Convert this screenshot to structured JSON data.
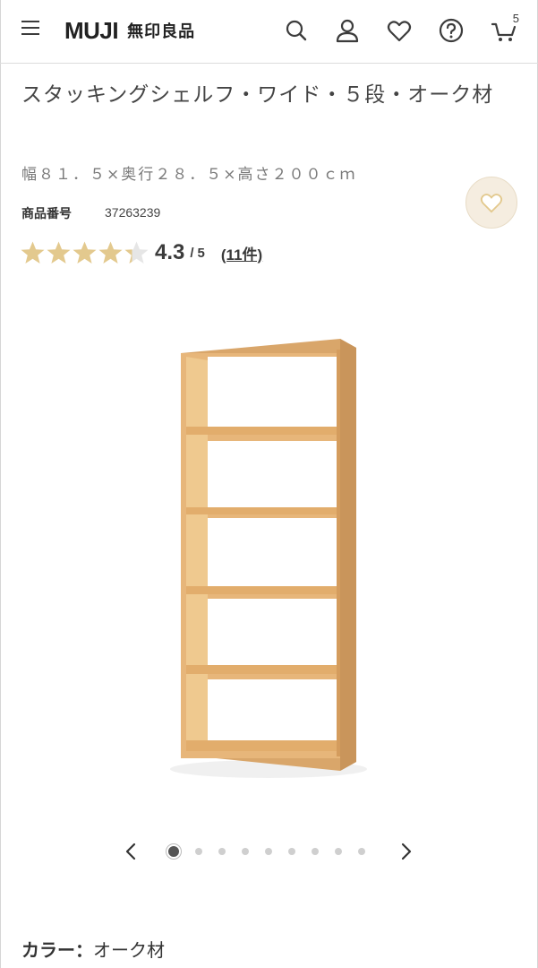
{
  "header": {
    "logo_en": "MUJI",
    "logo_jp": "無印良品",
    "icons": [
      "hamburger-menu-icon",
      "search-icon",
      "user-icon",
      "heart-icon",
      "help-icon",
      "cart-icon"
    ],
    "cart_count": "5"
  },
  "product": {
    "title": "スタッキングシェルフ・ワイド・５段・オーク材",
    "size": "幅８１．５×奥行２８．５×高さ２００ｃｍ",
    "code_label": "商品番号",
    "code_value": "37263239",
    "rating_score": "4.3",
    "rating_slash": "/",
    "rating_max": "5",
    "rating_value": 4.3,
    "review_count": "(11件)",
    "color_label": "カラー：",
    "color_value": "オーク材"
  },
  "carousel": {
    "total": 9,
    "active": 0
  },
  "colors": {
    "star": "#e3c98e",
    "star_empty": "#e6e6e6",
    "fav_bg": "#f5ede0",
    "wood": "#e7b67a"
  }
}
